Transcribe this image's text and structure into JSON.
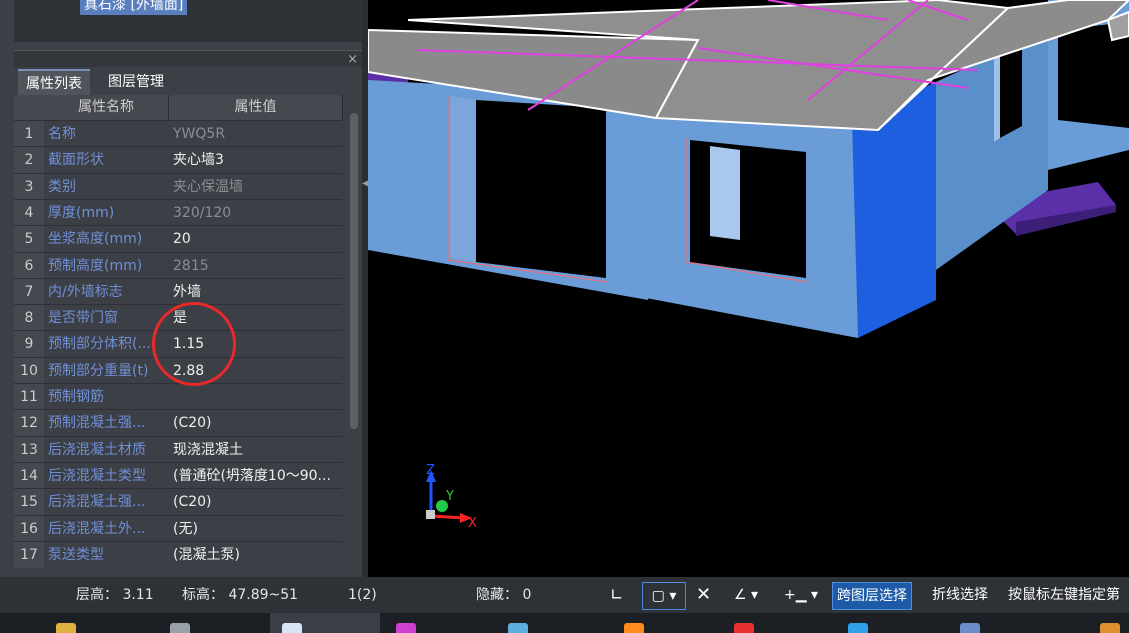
{
  "top_strip": {
    "item_label": "真石漆 [外墙面]"
  },
  "panel": {
    "close": "×"
  },
  "tabs": [
    {
      "label": "属性列表"
    },
    {
      "label": "图层管理"
    }
  ],
  "grid": {
    "headers": [
      "属性名称",
      "属性值"
    ],
    "rows": [
      {
        "n": "1",
        "name": "名称",
        "value": "YWQ5R",
        "dim": true
      },
      {
        "n": "2",
        "name": "截面形状",
        "value": "夹心墙3",
        "dim": false
      },
      {
        "n": "3",
        "name": "类别",
        "value": "夹心保温墙",
        "dim": true
      },
      {
        "n": "4",
        "name": "厚度(mm)",
        "value": "320/120",
        "dim": true
      },
      {
        "n": "5",
        "name": "坐浆高度(mm)",
        "value": "20",
        "dim": false
      },
      {
        "n": "6",
        "name": "预制高度(mm)",
        "value": "2815",
        "dim": true
      },
      {
        "n": "7",
        "name": "内/外墙标志",
        "value": "外墙",
        "dim": false
      },
      {
        "n": "8",
        "name": "是否带门窗",
        "value": "是",
        "dim": false
      },
      {
        "n": "9",
        "name": "预制部分体积(...",
        "value": "1.15",
        "dim": false
      },
      {
        "n": "10",
        "name": "预制部分重量(t)",
        "value": "2.88",
        "dim": false
      },
      {
        "n": "11",
        "name": "预制钢筋",
        "value": "",
        "dim": false
      },
      {
        "n": "12",
        "name": "预制混凝土强...",
        "value": "(C20)",
        "dim": false
      },
      {
        "n": "13",
        "name": "后浇混凝土材质",
        "value": "现浇混凝土",
        "dim": false
      },
      {
        "n": "14",
        "name": "后浇混凝土类型",
        "value": "(普通砼(坍落度10～90...",
        "dim": false
      },
      {
        "n": "15",
        "name": "后浇混凝土强...",
        "value": "(C20)",
        "dim": false
      },
      {
        "n": "16",
        "name": "后浇混凝土外...",
        "value": "(无)",
        "dim": false
      },
      {
        "n": "17",
        "name": "泵送类型",
        "value": "(混凝土泵)",
        "dim": false
      }
    ]
  },
  "axes": {
    "x": "X",
    "y": "Y",
    "z": "Z"
  },
  "status": {
    "floor_height": "层高：  3.11",
    "elevation": "标高：  47.89~51",
    "count": "1(2)",
    "hidden": "隐藏：  0",
    "cross_layer": "跨图层选择",
    "polyline": "折线选择",
    "hint": "按鼠标左键指定第"
  },
  "colors": {
    "panel_bg": "#3c3f45",
    "name_text": "#6f8fd6",
    "highlight_circle": "#e8282b",
    "wall": "#6a9cd8",
    "roof_grid": "#e040e0",
    "active_button": "#1d5aa8"
  }
}
